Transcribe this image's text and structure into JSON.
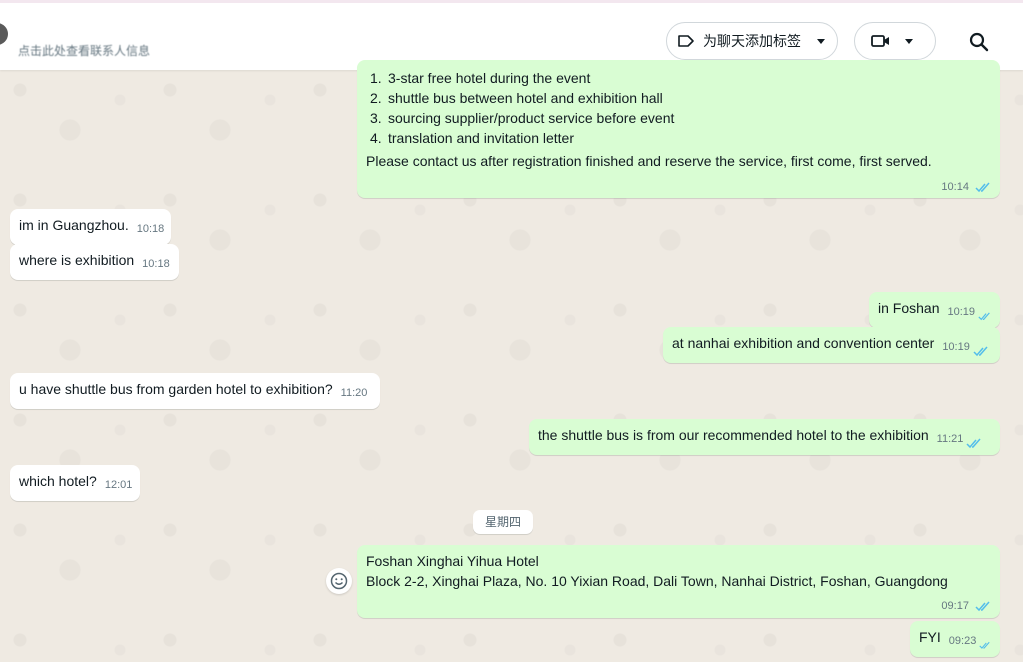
{
  "header": {
    "contact_subtitle": "点击此处查看联系人信息",
    "label_button": "为聊天添加标签"
  },
  "day_separator": "星期四",
  "messages": [
    {
      "list": [
        {
          "n": "1.",
          "text": "3-star free hotel during the event"
        },
        {
          "n": "2.",
          "text": "shuttle bus between hotel and exhibition hall"
        },
        {
          "n": "3.",
          "text": "sourcing supplier/product service before event"
        },
        {
          "n": "4.",
          "text": "translation and invitation letter"
        }
      ],
      "text": "Please contact us after registration finished and reserve the service, first come, first served.",
      "time": "10:14"
    },
    {
      "text": "im in Guangzhou.",
      "time": "10:18"
    },
    {
      "text": "where is exhibition",
      "time": "10:18"
    },
    {
      "text": "in Foshan",
      "time": "10:19"
    },
    {
      "text": "at nanhai exhibition and convention center",
      "time": "10:19"
    },
    {
      "text": "u have shuttle bus from garden hotel to exhibition?",
      "time": "11:20"
    },
    {
      "text": "the shuttle bus is from our recommended hotel to the exhibition",
      "time": "11:21"
    },
    {
      "text": "which hotel?",
      "time": "12:01"
    },
    {
      "line1": "Foshan Xinghai Yihua Hotel",
      "line2": "Block 2-2, Xinghai Plaza, No. 10 Yixian Road, Dali Town, Nanhai District, Foshan, Guangdong",
      "time": "09:17"
    },
    {
      "text": "FYI",
      "time": "09:23"
    }
  ],
  "colors": {
    "outgoing_bubble": "#d9fdd3",
    "incoming_bubble": "#ffffff",
    "read_ticks": "#53bdeb",
    "chat_background": "#efeae2"
  }
}
